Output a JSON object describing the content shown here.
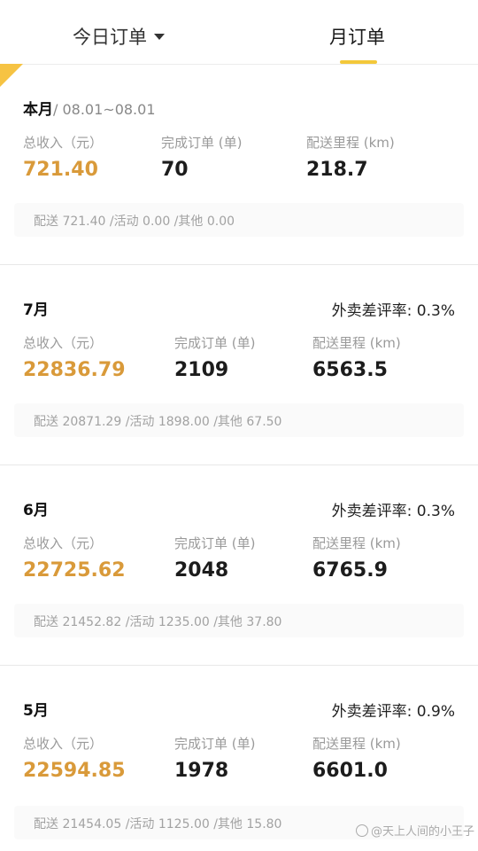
{
  "tabs": {
    "today_label": "今日订单",
    "month_label": "月订单"
  },
  "labels": {
    "income": "总收入（元）",
    "orders": "完成订单 (单)",
    "distance": "配送里程 (km)"
  },
  "current": {
    "title": "本月",
    "range": "/ 08.01~08.01",
    "income": "721.40",
    "orders": "70",
    "distance": "218.7",
    "breakdown": "配送 721.40 /活动 0.00 /其他 0.00"
  },
  "months": [
    {
      "title": "7月",
      "rate": "外卖差评率: 0.3%",
      "income": "22836.79",
      "orders": "2109",
      "distance": "6563.5",
      "breakdown": "配送 20871.29 /活动 1898.00 /其他 67.50"
    },
    {
      "title": "6月",
      "rate": "外卖差评率: 0.3%",
      "income": "22725.62",
      "orders": "2048",
      "distance": "6765.9",
      "breakdown": "配送 21452.82 /活动 1235.00 /其他 37.80"
    },
    {
      "title": "5月",
      "rate": "外卖差评率: 0.9%",
      "income": "22594.85",
      "orders": "1978",
      "distance": "6601.0",
      "breakdown": "配送 21454.05 /活动 1125.00 /其他 15.80"
    }
  ],
  "watermark": "@天上人间的小王子",
  "colors": {
    "accent": "#f3c83a",
    "income": "#d99a3a"
  }
}
